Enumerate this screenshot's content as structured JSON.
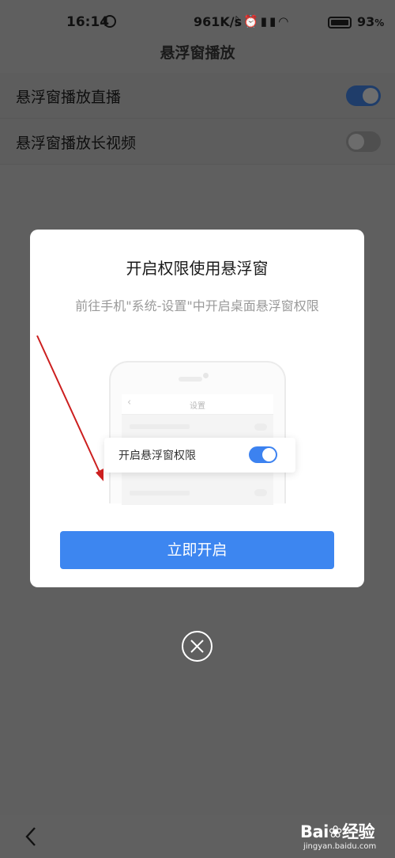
{
  "status_bar": {
    "time": "16:14",
    "net_speed": "961K/s",
    "icons": [
      "bluetooth-icon",
      "alarm-icon",
      "signal-hd-icon",
      "signal-hd-icon",
      "wifi-icon",
      "battery-icon"
    ],
    "battery_value": "93",
    "battery_unit": "%"
  },
  "header": {
    "title": "悬浮窗播放"
  },
  "settings": [
    {
      "label": "悬浮窗播放直播",
      "toggle": "on"
    },
    {
      "label": "悬浮窗播放长视频",
      "toggle": "off"
    }
  ],
  "dialog": {
    "title": "开启权限使用悬浮窗",
    "description": "前往手机\"系统-设置\"中开启桌面悬浮窗权限",
    "illustration": {
      "screen_title": "设置",
      "back_glyph": "‹",
      "card_label": "开启悬浮窗权限",
      "card_toggle": "on"
    },
    "button_label": "立即开启"
  },
  "close_button": {
    "icon": "close-icon"
  },
  "bottom_bar": {
    "back_icon": "chevron-left-icon"
  },
  "watermark": {
    "logo_left": "Bai",
    "logo_right": "经验",
    "url": "jingyan.baidu.com"
  },
  "colors": {
    "overlay": "#5f5f5f",
    "dialog_bg": "#ffffff",
    "primary_button": "#3d86f0",
    "toggle_on": "#3c82f0",
    "annotation_arrow": "#cc1f1f"
  }
}
